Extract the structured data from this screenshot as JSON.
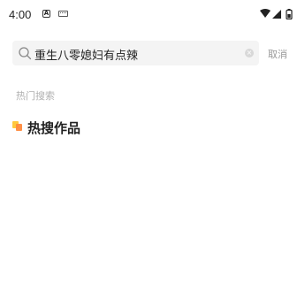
{
  "status_bar": {
    "time": "4:00",
    "notification_icons": [
      "a-letter-icon",
      "keyboard-icon"
    ],
    "system_icons": [
      "wifi-icon",
      "signal-icon",
      "battery-icon"
    ]
  },
  "search": {
    "query": "重生八零媳妇有点辣",
    "cancel_label": "取消"
  },
  "sections": {
    "hot_search_label": "热门搜索",
    "hot_works_title": "热搜作品"
  },
  "colors": {
    "accent_yellow": "#ffc83d",
    "accent_orange": "#ff8a3d",
    "muted_text": "#b0b0b0"
  }
}
